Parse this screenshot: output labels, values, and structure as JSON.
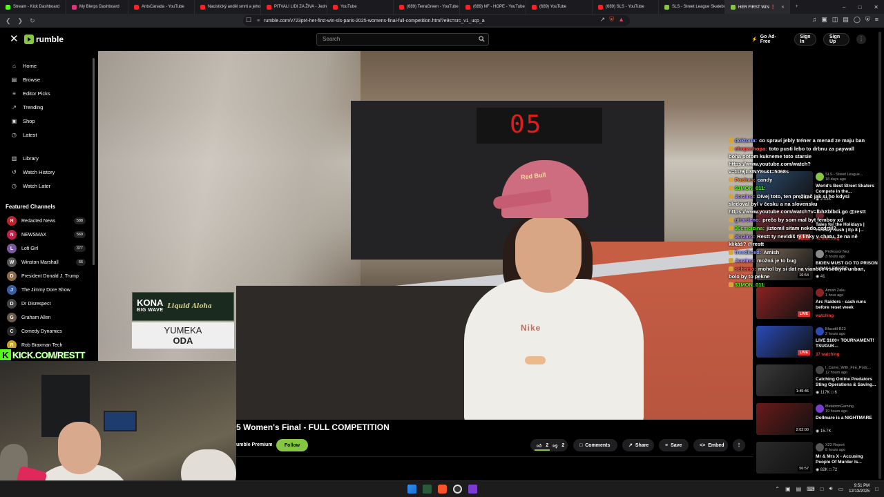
{
  "browser": {
    "tabs": [
      {
        "title": "Stream - Kick Dashboard",
        "color": "#53fc18"
      },
      {
        "title": "My Blerps Dashboard",
        "color": "#e0317d"
      },
      {
        "title": "AntsCanada - YouTube",
        "color": "#ff2020"
      },
      {
        "title": "Nacistický anděl smrti a jeho",
        "color": "#ff2020"
      },
      {
        "title": "PITVALI LIDI ZA ŽIVA - Jedn",
        "color": "#ff2020"
      },
      {
        "title": "YouTube",
        "color": "#ff2020"
      },
      {
        "title": "(689) TerraGreen - YouTube",
        "color": "#ff2020"
      },
      {
        "title": "(689) NF - HOPE - YouTube",
        "color": "#ff2020"
      },
      {
        "title": "(689) YouTube",
        "color": "#ff2020"
      },
      {
        "title": "(689) SLS - YouTube",
        "color": "#ff2020"
      },
      {
        "title": "SLS - Street League Skatebo",
        "color": "#85c742"
      },
      {
        "title": "HER FIRST WIN ❗",
        "color": "#85c742"
      }
    ],
    "url": "rumble.com/v723pt4-her-first-win-sls-paris-2025-womens-final-full-competition.html?e9s=src_v1_ucp_a"
  },
  "header": {
    "logo_text": "rumble",
    "search_placeholder": "Search",
    "go_adfree": "Go Ad-Free",
    "sign_in": "Sign In",
    "sign_up": "Sign Up",
    "menu": "⋮"
  },
  "sidebar": {
    "primary": [
      {
        "label": "Home",
        "icon": "⌂"
      },
      {
        "label": "Browse",
        "icon": "▤"
      },
      {
        "label": "Editor Picks",
        "icon": "≡"
      },
      {
        "label": "Trending",
        "icon": "↗"
      },
      {
        "label": "Shop",
        "icon": "▣"
      },
      {
        "label": "Latest",
        "icon": "◷"
      }
    ],
    "secondary": [
      {
        "label": "Library",
        "icon": "▥"
      },
      {
        "label": "Watch History",
        "icon": "↺"
      },
      {
        "label": "Watch Later",
        "icon": "◷"
      }
    ],
    "featured_title": "Featured Channels",
    "channels": [
      {
        "name": "Redacted News",
        "badge": "588",
        "color": "#b8242b",
        "initial": "R"
      },
      {
        "name": "NEWSMAX",
        "badge": "569",
        "color": "#c41f4a",
        "initial": "N"
      },
      {
        "name": "Lofi Girl",
        "badge": "377",
        "color": "#7a5a9c",
        "initial": "L"
      },
      {
        "name": "Winston Marshall",
        "badge": "66",
        "color": "#555",
        "initial": "W"
      },
      {
        "name": "President Donald J. Trump",
        "badge": "",
        "color": "#8a6b4a",
        "initial": "D"
      },
      {
        "name": "The Jimmy Dore Show",
        "badge": "",
        "color": "#3a5e9e",
        "initial": "J"
      },
      {
        "name": "Dr Disrespect",
        "badge": "",
        "color": "#444",
        "initial": "D"
      },
      {
        "name": "Graham Allen",
        "badge": "",
        "color": "#6a5a4a",
        "initial": "G"
      },
      {
        "name": "Comedy Dynamics",
        "badge": "",
        "color": "#2b2b2b",
        "initial": "C"
      },
      {
        "name": "Rob Braxman Tech",
        "badge": "",
        "color": "#c9a227",
        "initial": "R"
      }
    ]
  },
  "video": {
    "timer": "05",
    "sponsor_brand": "KONA",
    "sponsor_sub": "BIG WAVE",
    "sponsor_tag": "Liquid Aloha",
    "athlete_first": "YUMEKA",
    "athlete_last": "ODA",
    "cap_logo": "Red Bull",
    "shirt_text": "Nike"
  },
  "stream_overlay": {
    "kick_letter": "K",
    "kick_handle": "KICK.COM/RESTT"
  },
  "title_row": {
    "title": "5 Women's Final - FULL COMPETITION",
    "premium": "umble Premium",
    "follow": "Follow",
    "upvotes": "2",
    "downvotes": "2",
    "comments": "Comments",
    "share": "Share",
    "save": "Save",
    "embed": "Embed"
  },
  "chat": [
    {
      "user": "doktoria:",
      "color": "#8fa1ff",
      "text": "co spraví jebly tréner a menad ze maju ban"
    },
    {
      "user": "chopachopa:",
      "color": "#ff5a5a",
      "text": "toto pusti lebo to drbnu za paywall boha potom kukneme toto starsie https://www.youtube.com/watch?v=1U9jL3INY8s&t=5068s"
    },
    {
      "user": "Pochvo:",
      "color": "#ff8c3a",
      "text": "candy"
    },
    {
      "user": "$1MON_011:",
      "color": "#53fc18",
      "text": ""
    },
    {
      "user": "Jorzino:",
      "color": "#b48cff",
      "text": "Dívej toto, ten prežírač jak si ho kdysi sledoval byl v česku a na slovensku https://www.youtube.com/watch?v=lbhXblbdi.go @restt"
    },
    {
      "user": "girardeno:",
      "color": "#b48cff",
      "text": "prečo by som mal byt femboy xd"
    },
    {
      "user": "30cmcicina:",
      "color": "#53fc18",
      "text": "jiztomil sitam nekdo ozdrtil?"
    },
    {
      "user": "Jorzino:",
      "color": "#b48cff",
      "text": "Restt ty nevidíš ty linky v chatu, že na ně klikáš? @restt"
    },
    {
      "user": "freedkoxd:",
      "color": "#8fa1ff",
      "text": "Amish"
    },
    {
      "user": "Jorzino:",
      "color": "#b48cff",
      "text": "možná je to bug"
    },
    {
      "user": "schemo:",
      "color": "#ff5a5a",
      "text": "mohol by si dat na vianoce vsetkym unban, bolo by to pekne"
    },
    {
      "user": "$1MON_011:",
      "color": "#53fc18",
      "text": ""
    }
  ],
  "recommendations": [
    {
      "channel": "SLS - Street League...",
      "ago": "18 days ago",
      "title": "World's Best Street Skaters Compete in the...",
      "meta": "2.03K",
      "duration": "26:00",
      "live": false,
      "thumb": "#2d4a6e"
    },
    {
      "channel": "",
      "ago": "",
      "title": "Tales for the Holidays | Holiday Rush | Ep 8 |...",
      "meta": "",
      "watching": "42 watching",
      "duration": "",
      "live": true,
      "thumb": "#6a2a30"
    },
    {
      "channel": "Professor Nez",
      "ago": "3 hours ago",
      "title": "BIDEN MUST GO TO PRISON NOW! LEAKED...",
      "meta": "41",
      "duration": "16:54",
      "live": false,
      "thumb": "#7a6a5a"
    },
    {
      "channel": "Amish Zaku",
      "ago": "1 hour ago",
      "title": "Arc Raiders - cash runs before reset week",
      "meta": "",
      "watching": "watching",
      "duration": "",
      "live": true,
      "thumb": "#8a2222"
    },
    {
      "channel": "Blacottl-B23",
      "ago": "2 hours ago",
      "title": "LIVE $100+ TOURNAMENT! TSUGUK...",
      "meta": "",
      "watching": "37 watching",
      "duration": "",
      "live": true,
      "thumb": "#2a4bb8"
    },
    {
      "channel": "I_Came_With_Fire_Podc...",
      "ago": "12 hours ago",
      "title": "Catching Online Predators Sting Operations & Saving...",
      "meta": "117K",
      "comments": "6",
      "duration": "1:45:46",
      "live": false,
      "thumb": "#3a3a3a"
    },
    {
      "channel": "MetatronGaming",
      "ago": "19 hours ago",
      "title": "Dollmare is a NIGHTMARE",
      "meta": "15.7K",
      "duration": "2:02:00",
      "live": false,
      "thumb": "#6a1a1a"
    },
    {
      "channel": "X22 Report",
      "ago": "8 hours ago",
      "title": "Mr & Mrs X - Accusing People Of Murder Is...",
      "meta": "82K",
      "comments": "72",
      "duration": "56:57",
      "live": false,
      "thumb": "#2a2a2a"
    }
  ],
  "taskbar": {
    "time": "9:51 PM",
    "date": "12/13/2025"
  }
}
